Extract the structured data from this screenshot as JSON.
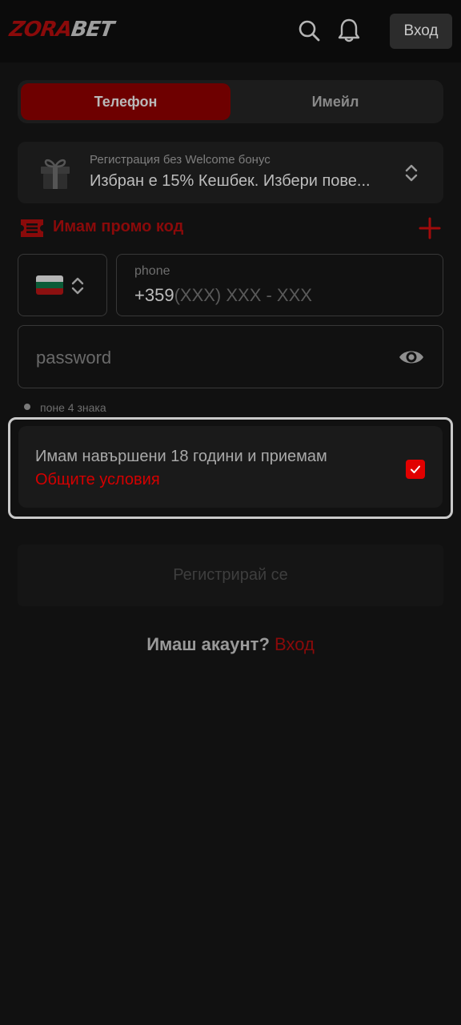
{
  "header": {
    "logo_part1": "ZORA",
    "logo_part2": "BET",
    "login_label": "Вход"
  },
  "tabs": [
    {
      "label": "Телефон",
      "active": true
    },
    {
      "label": "Имейл",
      "active": false
    }
  ],
  "bonus": {
    "subtitle": "Регистрация без Welcome бонус",
    "selected": "Избран е 15% Кешбек. Избери пове..."
  },
  "promo": {
    "label": "Имам промо код"
  },
  "phone": {
    "label": "phone",
    "prefix": "+359",
    "mask": "(XXX) XXX - XXX"
  },
  "password": {
    "placeholder": "password"
  },
  "hint": {
    "text": "поне 4 знака"
  },
  "terms": {
    "text": "Имам навършени 18 години и приемам",
    "link": "Общите условия",
    "checked": true
  },
  "register": {
    "label": "Регистрирай се"
  },
  "account": {
    "question": "Имаш акаунт?",
    "link": "Вход"
  },
  "colors": {
    "accent": "#e10000",
    "accent_dark": "#8a0a0a",
    "background": "#111111"
  }
}
